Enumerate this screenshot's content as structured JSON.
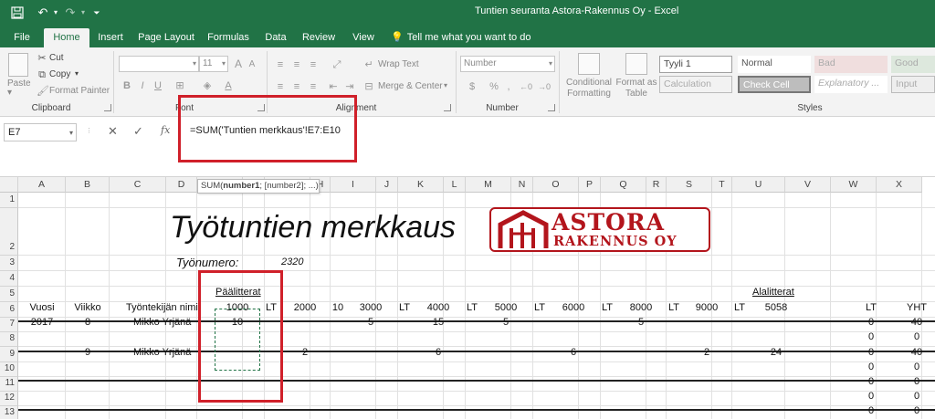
{
  "window": {
    "title": "Tuntien seuranta Astora-Rakennus Oy - Excel"
  },
  "quick_access": [
    "save-icon",
    "undo-icon",
    "redo-icon",
    "customize-icon"
  ],
  "tabs": [
    "File",
    "Home",
    "Insert",
    "Page Layout",
    "Formulas",
    "Data",
    "Review",
    "View"
  ],
  "active_tab": "Home",
  "tell_me": "Tell me what you want to do",
  "ribbon": {
    "clipboard": {
      "paste": "Paste",
      "cut": "Cut",
      "copy": "Copy",
      "format_painter": "Format Painter",
      "label": "Clipboard"
    },
    "font": {
      "font_size": "11",
      "bold": "B",
      "italic": "I",
      "underline": "U",
      "grow": "A",
      "shrink": "A",
      "font_color": "A",
      "label": "Font"
    },
    "alignment": {
      "wrap_text": "Wrap Text",
      "merge_center": "Merge & Center",
      "label": "Alignment"
    },
    "number": {
      "format": "Number",
      "currency": "$",
      "percent": "%",
      "comma": ",",
      "label": "Number"
    },
    "styles": {
      "conditional_formatting": [
        "Conditional",
        "Formatting"
      ],
      "format_as_table": [
        "Format as",
        "Table"
      ],
      "cell_styles": [
        "Tyyli 1",
        "Normal",
        "Bad",
        "Good",
        "Calculation",
        "Check Cell",
        "Explanatory ...",
        "Input"
      ],
      "label": "Styles"
    }
  },
  "formula_bar": {
    "name_box": "E7",
    "cancel": "✕",
    "enter": "✓",
    "fx": "fx",
    "formula": "=SUM('Tuntien merkkaus'!E7:E10",
    "tooltip_fn": "SUM(",
    "tooltip_arg1": "number1",
    "tooltip_rest": "; [number2]; ...)"
  },
  "grid": {
    "columns": [
      "A",
      "B",
      "C",
      "D",
      "E",
      "F",
      "G",
      "H",
      "I",
      "J",
      "K",
      "L",
      "M",
      "N",
      "O",
      "P",
      "Q",
      "R",
      "S",
      "T",
      "U",
      "V",
      "W",
      "X"
    ],
    "rows": [
      "1",
      "2",
      "3",
      "4",
      "5",
      "6",
      "7",
      "8",
      "9",
      "10",
      "11",
      "12",
      "13"
    ]
  },
  "sheet": {
    "title": "Työtuntien merkkaus",
    "tyonumero_label": "Työnumero:",
    "tyonumero_value": "2320",
    "logo_line1": "ASTORA",
    "logo_line2": "RAKENNUS OY",
    "paalitterat": "Päälitterat",
    "alalitterat": "Alalitterat",
    "headers": {
      "vuosi": "Vuosi",
      "viikko": "Viikko",
      "tyontekija": "Työntekijän nimi",
      "c1000": "1000",
      "lt1": "LT",
      "c2000": "2000",
      "c10": "10",
      "c3000": "3000",
      "lt2": "LT",
      "c4000": "4000",
      "lt3": "LT",
      "c5000": "5000",
      "lt4": "LT",
      "c6000": "6000",
      "lt5": "LT",
      "c8000": "8000",
      "lt6": "LT",
      "c9000": "9000",
      "lt7": "LT",
      "c5058": "5058",
      "lt8": "LT",
      "yht": "YHT"
    },
    "row7": {
      "vuosi": "2017",
      "viikko": "8",
      "nimi": "Mikko Yrjänä",
      "c1000": "10",
      "c3000": "5",
      "c4000": "15",
      "c5000": "5",
      "c8000": "5",
      "lt": "0",
      "yht": "40"
    },
    "row8": {
      "lt": "0",
      "yht": "0"
    },
    "row9": {
      "viikko": "9",
      "nimi": "Mikko Yrjänä",
      "c2000": "2",
      "c4000": "6",
      "c6000": "6",
      "c9000": "2",
      "c5058": "24",
      "lt": "0",
      "yht": "40"
    },
    "row10": {
      "lt": "0",
      "yht": "0"
    },
    "row11": {
      "lt": "0",
      "yht": "0"
    },
    "row12": {
      "lt": "0",
      "yht": "0"
    },
    "row13": {
      "lt": "0",
      "yht": "0"
    }
  },
  "colors": {
    "excel_green": "#217346",
    "highlight_red": "#d0202a",
    "logo_red": "#b3151c"
  }
}
